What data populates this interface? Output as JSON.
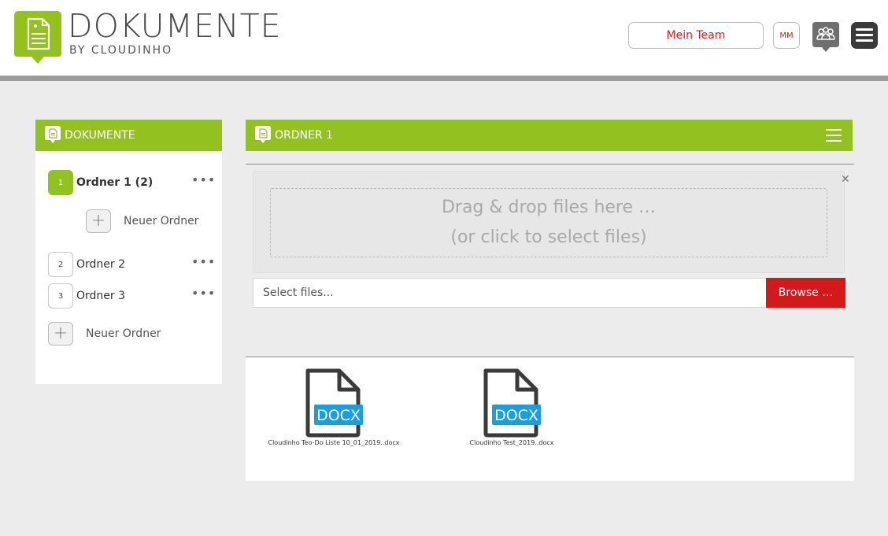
{
  "header": {
    "brand_title": "DOKUMENTE",
    "brand_sub": "BY CLOUDINHO",
    "team_button": "Mein Team",
    "avatar_initials": "MM",
    "icons": [
      "document-logo-icon",
      "users-icon",
      "menu-icon"
    ]
  },
  "sidebar": {
    "title": "DOKUMENTE",
    "folders": [
      {
        "number": "1",
        "label": "Ordner 1 (2)",
        "active": true
      },
      {
        "number": "2",
        "label": "Ordner 2",
        "active": false
      },
      {
        "number": "3",
        "label": "Ordner 3",
        "active": false
      }
    ],
    "sub_new_folder": "Neuer Ordner",
    "new_folder": "Neuer Ordner"
  },
  "main": {
    "title": "ORDNER 1",
    "dropzone": {
      "line1": "Drag & drop files here …",
      "line2": "(or click to select files)"
    },
    "file_input_placeholder": "Select files...",
    "browse_button": "Browse …",
    "files": [
      {
        "name": "Cloudinho Teo-Do Liste 10_01_2019..docx",
        "type": "DOCX"
      },
      {
        "name": "Cloudinho Test_2019..docx",
        "type": "DOCX"
      }
    ]
  },
  "colors": {
    "accent_green": "#93c11f",
    "accent_red": "#d5181a",
    "docx_blue": "#1a9ee0"
  }
}
